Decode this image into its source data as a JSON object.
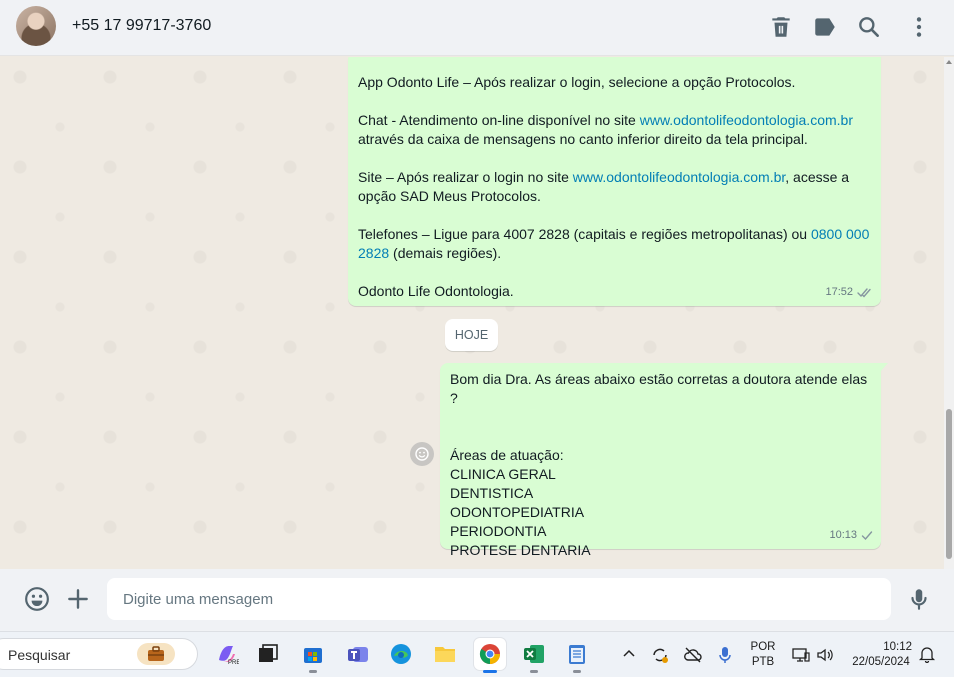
{
  "header": {
    "contact_name": "+55 17 99717-3760",
    "icons": [
      "delete-icon",
      "label-icon",
      "search-icon",
      "more-options-icon"
    ]
  },
  "messages": {
    "first": {
      "line1": "App Odonto Life – Após realizar o login, selecione a opção Protocolos.",
      "chat_prefix": "Chat - Atendimento on-line disponível no site ",
      "chat_link": "www.odontolifeodontologia.com.br",
      "chat_suffix": "através da caixa de mensagens no canto inferior direito da tela principal.",
      "site_prefix": "Site – Após realizar o login no site ",
      "site_link": "www.odontolifeodontologia.com.br",
      "site_suffix": ", acesse a opção SAD Meus Protocolos.",
      "phone_prefix": "Telefones – Ligue para 4007 2828 (capitais e regiões metropolitanas) ou ",
      "phone_link": "0800 000 2828",
      "phone_suffix": " (demais regiões).",
      "signature": "Odonto Life Odontologia.",
      "time": "17:52",
      "status": "read"
    },
    "day_divider": "HOJE",
    "second": {
      "line1": "Bom dia Dra. As áreas abaixo estão corretas a doutora atende elas ?",
      "areas_title": "Áreas de atuação:",
      "areas": [
        "CLINICA GERAL",
        "DENTISTICA",
        "ODONTOPEDIATRIA",
        "PERIODONTIA",
        "PROTESE DENTARIA"
      ],
      "time": "10:13",
      "status": "sent"
    }
  },
  "composer": {
    "placeholder": "Digite uma mensagem"
  },
  "taskbar": {
    "search_label": "Pesquisar",
    "apps": [
      "copilot-icon",
      "task-view-icon",
      "microsoft-store-icon",
      "teams-icon",
      "edge-icon",
      "file-explorer-icon",
      "chrome-icon",
      "excel-icon",
      "notepad-icon"
    ],
    "active_app": "chrome-icon",
    "lang_line1": "POR",
    "lang_line2": "PTB",
    "clock_time": "10:12",
    "clock_date": "22/05/2024"
  },
  "colors": {
    "outgoing_bubble": "#d9fdd3",
    "chat_background": "#efeae2",
    "link": "#027eb5",
    "read_tick": "#53bdeb"
  }
}
